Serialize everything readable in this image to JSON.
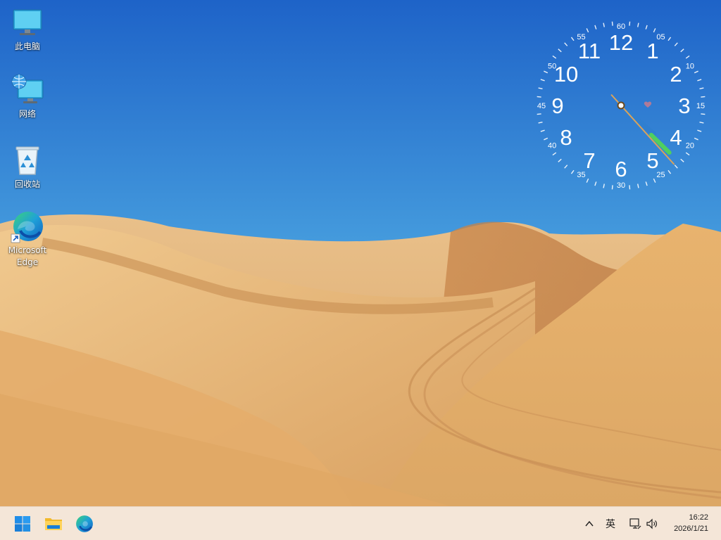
{
  "desktop": {
    "icons": [
      {
        "id": "this-pc",
        "label": "此电脑",
        "icon": "monitor-icon"
      },
      {
        "id": "network",
        "label": "网络",
        "icon": "network-globe-icon"
      },
      {
        "id": "recycle-bin",
        "label": "回收站",
        "icon": "recycle-bin-icon"
      },
      {
        "id": "edge",
        "label": "Microsoft Edge",
        "icon": "edge-icon"
      }
    ]
  },
  "clock_widget": {
    "hour_numerals": [
      "12",
      "1",
      "2",
      "3",
      "4",
      "5",
      "6",
      "7",
      "8",
      "9",
      "10",
      "11"
    ],
    "minute_labels": [
      "60",
      "05",
      "10",
      "15",
      "20",
      "25",
      "30",
      "35",
      "40",
      "45",
      "50",
      "55"
    ],
    "time": {
      "hours": 16,
      "minutes": 22,
      "seconds": 23
    },
    "colors": {
      "hour_hand": "#2f7fd0",
      "minute_hand": "#4fcf5f",
      "second_hand": "#d9a35a",
      "numerals": "#ffffff"
    }
  },
  "taskbar": {
    "buttons": [
      {
        "id": "start",
        "icon": "windows-start-icon"
      },
      {
        "id": "file-explorer",
        "icon": "folder-icon"
      },
      {
        "id": "edge",
        "icon": "edge-icon"
      }
    ],
    "tray": {
      "overflow_icon": "chevron-up-icon",
      "input_language": "英",
      "network_icon": "network-monitor-icon",
      "volume_icon": "speaker-icon"
    },
    "clock": {
      "time": "16:22",
      "date": "2026/1/21"
    }
  },
  "colors": {
    "taskbar_bg": "#f4e6d8",
    "sky_top": "#1e63c8",
    "sky_bottom": "#8ed3ea",
    "sand": "#e7b273"
  }
}
